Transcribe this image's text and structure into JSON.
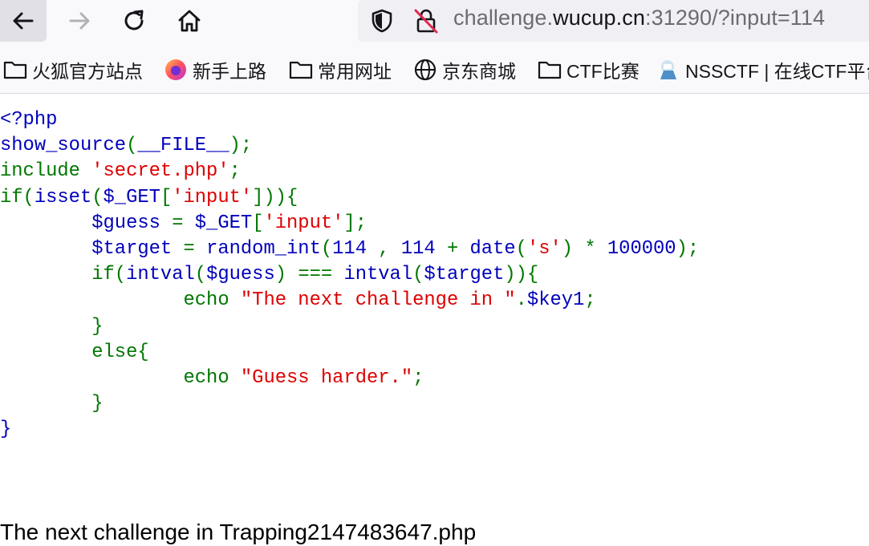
{
  "browser": {
    "url_host_pre": "challenge.",
    "url_host": "wucup.cn",
    "url_rest": ":31290/?input=114"
  },
  "bookmarks": [
    {
      "label": "火狐官方站点",
      "icon": "folder-icon"
    },
    {
      "label": "新手上路",
      "icon": "firefox-icon"
    },
    {
      "label": "常用网址",
      "icon": "folder-icon"
    },
    {
      "label": "京东商城",
      "icon": "globe-icon"
    },
    {
      "label": "CTF比赛",
      "icon": "folder-icon"
    },
    {
      "label": "NSSCTF | 在线CTF平台",
      "icon": "nssctf-favicon"
    }
  ],
  "code": {
    "l1a": "<",
    "l1b": "?php",
    "l2a": "show_source",
    "l2b": "(",
    "l2c": "__FILE__",
    "l2d": ");",
    "l3a": "include ",
    "l3b": "'secret.php'",
    "l3c": ";",
    "l4a": "if(",
    "l4b": "isset",
    "l4c": "(",
    "l4d": "$_GET",
    "l4e": "[",
    "l4f": "'input'",
    "l4g": "])){",
    "l5a": "$guess ",
    "l5b": "= ",
    "l5c": "$_GET",
    "l5d": "[",
    "l5e": "'input'",
    "l5f": "];",
    "l6a": "$target ",
    "l6b": "= ",
    "l6c": "random_int",
    "l6d": "(",
    "l6e": "114 ",
    "l6f": ", ",
    "l6g": "114 ",
    "l6h": "+ ",
    "l6i": "date",
    "l6j": "(",
    "l6k": "'s'",
    "l6l": ") ",
    "l6m": "* ",
    "l6n": "100000",
    "l6o": ");",
    "l7a": "if(",
    "l7b": "intval",
    "l7c": "(",
    "l7d": "$guess",
    "l7e": ") ",
    "l7f": "=== ",
    "l7g": "intval",
    "l7h": "(",
    "l7i": "$target",
    "l7j": ")){",
    "l8a": "echo ",
    "l8b": "\"The next challenge in \"",
    "l8c": ".",
    "l8d": "$key1",
    "l8e": ";",
    "l9": "}",
    "l10": "else{",
    "l11a": "echo ",
    "l11b": "\"Guess harder.\"",
    "l11c": ";",
    "l12": "}",
    "l13": "}"
  },
  "output": "The next challenge in Trapping2147483647.php",
  "colors": {
    "keyword": "#007700",
    "default": "#0000bb",
    "string": "#dd0000"
  }
}
